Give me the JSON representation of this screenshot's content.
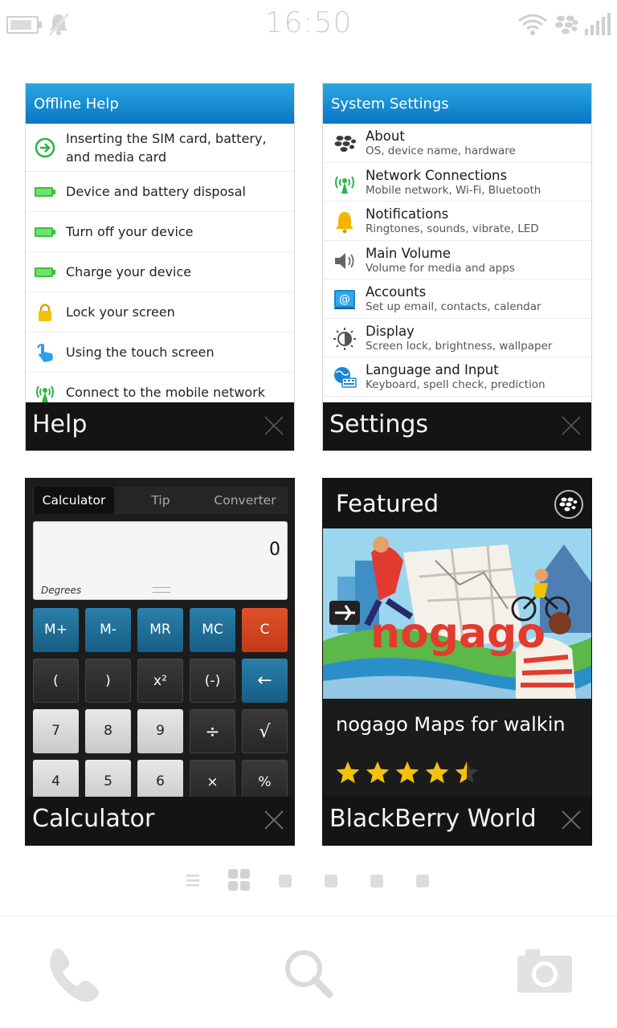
{
  "status": {
    "time": "16:50",
    "battery_level": 0.85
  },
  "help": {
    "header": "Offline Help",
    "items": [
      {
        "label": "Inserting the SIM card, battery, and media card",
        "icon": "arrow-circle-icon"
      },
      {
        "label": "Device and battery disposal",
        "icon": "battery-icon"
      },
      {
        "label": "Turn off your device",
        "icon": "battery-icon"
      },
      {
        "label": "Charge your device",
        "icon": "battery-icon"
      },
      {
        "label": "Lock your screen",
        "icon": "lock-icon"
      },
      {
        "label": "Using the touch screen",
        "icon": "touch-icon"
      },
      {
        "label": "Connect to the mobile network",
        "icon": "antenna-icon"
      }
    ],
    "footer": "Help"
  },
  "settings": {
    "header": "System Settings",
    "items": [
      {
        "title": "About",
        "sub": "OS, device name, hardware",
        "icon": "blackberry-icon"
      },
      {
        "title": "Network Connections",
        "sub": "Mobile network, Wi-Fi, Bluetooth",
        "icon": "antenna-icon"
      },
      {
        "title": "Notifications",
        "sub": "Ringtones, sounds, vibrate, LED",
        "icon": "bell-icon"
      },
      {
        "title": "Main Volume",
        "sub": "Volume for media and apps",
        "icon": "speaker-icon"
      },
      {
        "title": "Accounts",
        "sub": "Set up email, contacts, calendar",
        "icon": "at-icon"
      },
      {
        "title": "Display",
        "sub": "Screen lock, brightness, wallpaper",
        "icon": "display-icon"
      },
      {
        "title": "Language and Input",
        "sub": "Keyboard, spell check, prediction",
        "icon": "globe-keyboard-icon"
      }
    ],
    "footer": "Settings"
  },
  "calculator": {
    "tabs": [
      "Calculator",
      "Tip",
      "Converter"
    ],
    "active_tab": "Calculator",
    "display_value": "0",
    "mode": "Degrees",
    "keys": {
      "row1": [
        "M+",
        "M-",
        "MR",
        "MC",
        "C"
      ],
      "row2": [
        "(",
        ")",
        "x²",
        "(-)",
        "←"
      ],
      "row3": [
        "7",
        "8",
        "9",
        "÷",
        "√"
      ],
      "row4": [
        "4",
        "5",
        "6",
        "×",
        "%"
      ]
    },
    "footer": "Calculator"
  },
  "bbworld": {
    "header": "Featured",
    "app_name": "nogago Maps for walkin",
    "art_text": "nogago",
    "rating": 4.5,
    "footer": "BlackBerry World"
  },
  "colors": {
    "accent_blue": "#0a76c4",
    "key_blue": "#1f6f98",
    "key_red": "#d6461f",
    "star_gold": "#f4c20d"
  }
}
